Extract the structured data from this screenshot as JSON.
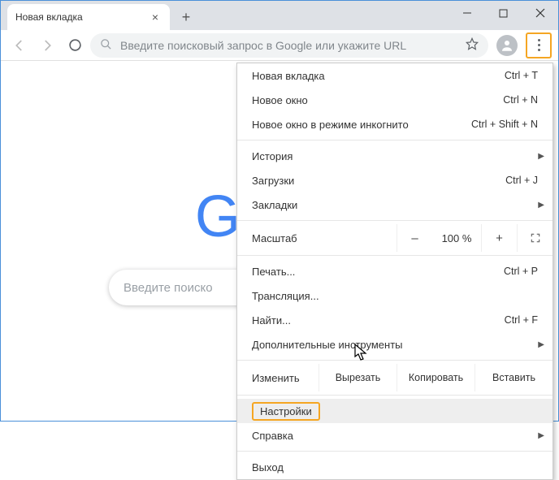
{
  "tab": {
    "title": "Новая вкладка"
  },
  "omnibox": {
    "placeholder": "Введите поисковый запрос в Google или укажите URL"
  },
  "searchbox": {
    "placeholder": "Введите поиско"
  },
  "menu": {
    "new_tab": {
      "label": "Новая вкладка",
      "shortcut": "Ctrl + T"
    },
    "new_window": {
      "label": "Новое окно",
      "shortcut": "Ctrl + N"
    },
    "incognito": {
      "label": "Новое окно в режиме инкогнито",
      "shortcut": "Ctrl + Shift + N"
    },
    "history": {
      "label": "История"
    },
    "downloads": {
      "label": "Загрузки",
      "shortcut": "Ctrl + J"
    },
    "bookmarks": {
      "label": "Закладки"
    },
    "zoom": {
      "label": "Масштаб",
      "minus": "–",
      "value": "100 %",
      "plus": "+"
    },
    "print": {
      "label": "Печать...",
      "shortcut": "Ctrl + P"
    },
    "cast": {
      "label": "Трансляция..."
    },
    "find": {
      "label": "Найти...",
      "shortcut": "Ctrl + F"
    },
    "more_tools": {
      "label": "Дополнительные инструменты"
    },
    "edit": {
      "label": "Изменить",
      "cut": "Вырезать",
      "copy": "Копировать",
      "paste": "Вставить"
    },
    "settings": {
      "label": "Настройки"
    },
    "help": {
      "label": "Справка"
    },
    "exit": {
      "label": "Выход"
    }
  }
}
